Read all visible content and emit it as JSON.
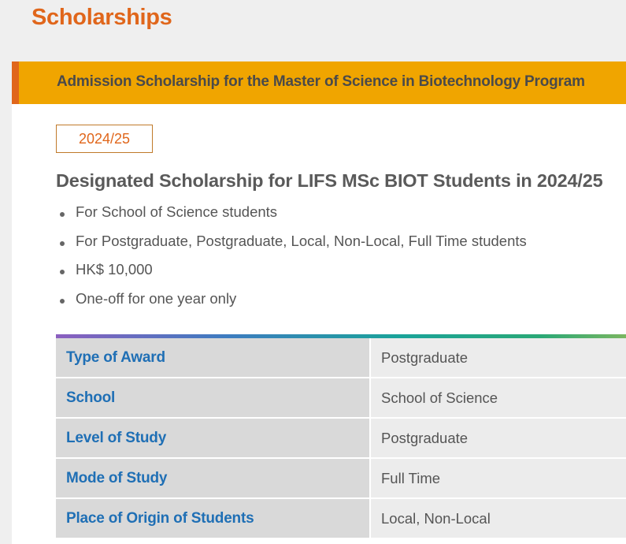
{
  "page": {
    "title": "Scholarships"
  },
  "card": {
    "header": "Admission Scholarship for the Master of Science in Biotechnology Program",
    "year": "2024/25",
    "title": "Designated Scholarship for LIFS MSc BIOT Students in 2024/25",
    "bullets": [
      "For School of Science students",
      "For Postgraduate, Postgraduate, Local, Non-Local, Full Time students",
      "HK$ 10,000",
      "One-off for one year only"
    ],
    "details": [
      {
        "label": "Type of Award",
        "value": "Postgraduate"
      },
      {
        "label": "School",
        "value": "School of Science"
      },
      {
        "label": "Level of Study",
        "value": "Postgraduate"
      },
      {
        "label": "Mode of Study",
        "value": "Full Time"
      },
      {
        "label": "Place of Origin of Students",
        "value": "Local, Non-Local"
      }
    ]
  },
  "colors": {
    "accent_orange": "#e0661b",
    "header_yellow": "#f0a500",
    "label_blue": "#1f6fb5"
  }
}
